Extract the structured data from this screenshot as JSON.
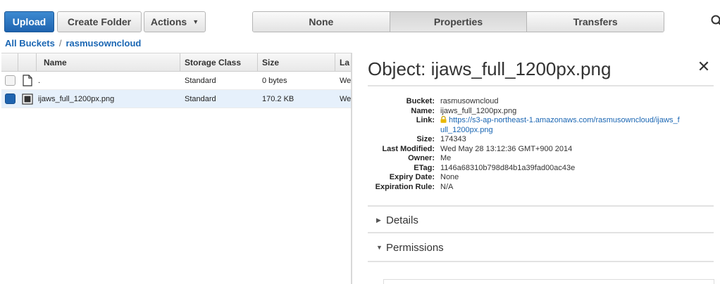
{
  "toolbar": {
    "upload_label": "Upload",
    "create_folder_label": "Create Folder",
    "actions_label": "Actions"
  },
  "view_tabs": [
    {
      "label": "None",
      "active": false
    },
    {
      "label": "Properties",
      "active": true
    },
    {
      "label": "Transfers",
      "active": false
    }
  ],
  "breadcrumb": {
    "root": "All Buckets",
    "separator": "/",
    "current": "rasmusowncloud"
  },
  "table": {
    "columns": {
      "name": "Name",
      "storage_class": "Storage Class",
      "size": "Size",
      "last_modified": "La"
    },
    "rows": [
      {
        "name": ".",
        "storage_class": "Standard",
        "size": "0 bytes",
        "last_modified": "Wed",
        "selected": false,
        "icon": "file-icon"
      },
      {
        "name": "ijaws_full_1200px.png",
        "storage_class": "Standard",
        "size": "170.2 KB",
        "last_modified": "Wed",
        "selected": true,
        "icon": "image-file-icon"
      }
    ]
  },
  "panel": {
    "title": "Object: ijaws_full_1200px.png",
    "properties": {
      "bucket_label": "Bucket:",
      "bucket": "rasmusowncloud",
      "name_label": "Name:",
      "name": "ijaws_full_1200px.png",
      "link_label": "Link:",
      "link": "https://s3-ap-northeast-1.amazonaws.com/rasmusowncloud/ijaws_full_1200px.png",
      "size_label": "Size:",
      "size": "174343",
      "last_modified_label": "Last Modified:",
      "last_modified": "Wed May 28 13:12:36 GMT+900 2014",
      "owner_label": "Owner:",
      "owner": "Me",
      "etag_label": "ETag:",
      "etag": "1146a68310b798d84b1a39fad00ac43e",
      "expiry_date_label": "Expiry Date:",
      "expiry_date": "None",
      "expiration_rule_label": "Expiration Rule:",
      "expiration_rule": "N/A"
    },
    "sections": {
      "details": "Details",
      "permissions": "Permissions"
    }
  },
  "colors": {
    "primary_button": "#1f64b0",
    "link": "#1a66b3",
    "selected_row": "#e6f0fb"
  }
}
